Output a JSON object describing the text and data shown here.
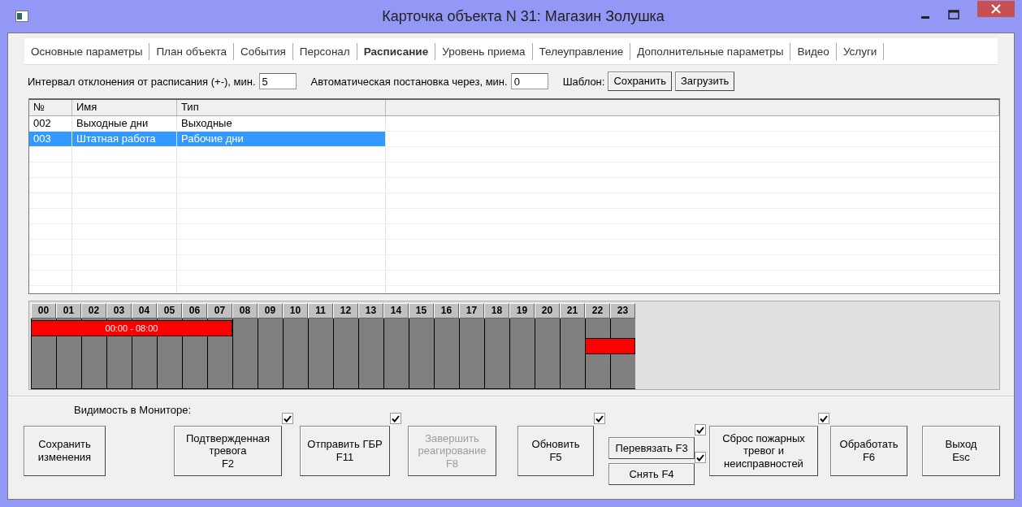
{
  "window": {
    "title": "Карточка объекта N 31: Магазин Золушка"
  },
  "tabs": [
    {
      "label": "Основные параметры",
      "selected": false
    },
    {
      "label": "План объекта",
      "selected": false
    },
    {
      "label": "События",
      "selected": false
    },
    {
      "label": "Персонал",
      "selected": false
    },
    {
      "label": "Расписание",
      "selected": true
    },
    {
      "label": "Уровень приема",
      "selected": false
    },
    {
      "label": "Телеуправление",
      "selected": false
    },
    {
      "label": "Дополнительные параметры",
      "selected": false
    },
    {
      "label": "Видео",
      "selected": false
    },
    {
      "label": "Услуги",
      "selected": false
    }
  ],
  "toolbar": {
    "deviation_label": "Интервал отклонения от расписания (+-), мин.",
    "deviation_value": "5",
    "auto_label": "Автоматическая постановка через, мин.",
    "auto_value": "0",
    "template_label": "Шаблон:",
    "template_buttons": [
      "Сохранить",
      "Загрузить"
    ]
  },
  "table": {
    "columns": [
      "№",
      "Имя",
      "Тип"
    ],
    "rows": [
      {
        "cells": [
          "002",
          "Выходные дни",
          "Выходные"
        ],
        "selected": false
      },
      {
        "cells": [
          "003",
          "Штатная работа",
          "Рабочие дни"
        ],
        "selected": true
      }
    ]
  },
  "schedule": {
    "top_bar_label": "00:00 - 08:00",
    "hours": [
      {
        "label": "00",
        "top": true,
        "middle": false
      },
      {
        "label": "01",
        "top": true,
        "middle": false
      },
      {
        "label": "02",
        "top": true,
        "middle": false
      },
      {
        "label": "03",
        "top": true,
        "middle": false
      },
      {
        "label": "04",
        "top": true,
        "middle": false
      },
      {
        "label": "05",
        "top": true,
        "middle": false
      },
      {
        "label": "06",
        "top": true,
        "middle": false
      },
      {
        "label": "07",
        "top": true,
        "middle": false
      },
      {
        "label": "08",
        "top": false,
        "middle": false
      },
      {
        "label": "09",
        "top": false,
        "middle": false
      },
      {
        "label": "10",
        "top": false,
        "middle": false
      },
      {
        "label": "11",
        "top": false,
        "middle": false
      },
      {
        "label": "12",
        "top": false,
        "middle": false
      },
      {
        "label": "13",
        "top": false,
        "middle": false
      },
      {
        "label": "14",
        "top": false,
        "middle": false
      },
      {
        "label": "15",
        "top": false,
        "middle": false
      },
      {
        "label": "16",
        "top": false,
        "middle": false
      },
      {
        "label": "17",
        "top": false,
        "middle": false
      },
      {
        "label": "18",
        "top": false,
        "middle": false
      },
      {
        "label": "19",
        "top": false,
        "middle": false
      },
      {
        "label": "20",
        "top": false,
        "middle": false
      },
      {
        "label": "21",
        "top": false,
        "middle": false
      },
      {
        "label": "22",
        "top": false,
        "middle": true
      },
      {
        "label": "23",
        "top": false,
        "middle": true
      }
    ]
  },
  "bottom": {
    "monitor_label": "Видимость в Мониторе:",
    "controls": [
      {
        "kind": "button",
        "label": "Сохранить\nизменения",
        "disabled": false
      },
      {
        "kind": "button",
        "label": "Подтвержденная\nтревога\nF2",
        "disabled": false,
        "monitor_checked": true
      },
      {
        "kind": "button",
        "label": "Отправить ГБР\nF11",
        "disabled": false,
        "monitor_checked": true
      },
      {
        "kind": "button",
        "label": "Завершить\nреагирование\nF8",
        "disabled": true
      },
      {
        "kind": "button",
        "label": "Обновить\nF5",
        "disabled": false,
        "monitor_checked": true
      },
      {
        "kind": "stack",
        "buttons": [
          {
            "label": "Перевязать F3",
            "disabled": false,
            "monitor_checked": true
          },
          {
            "label": "Снять F4",
            "disabled": false,
            "monitor_checked": true
          }
        ]
      },
      {
        "kind": "button",
        "label": "Сброс пожарных\nтревог и\nнеисправностей",
        "disabled": false,
        "monitor_checked": true
      },
      {
        "kind": "button",
        "label": "Обработать\nF6",
        "disabled": false
      },
      {
        "kind": "button",
        "label": "Выход\nEsc",
        "disabled": false
      }
    ]
  }
}
